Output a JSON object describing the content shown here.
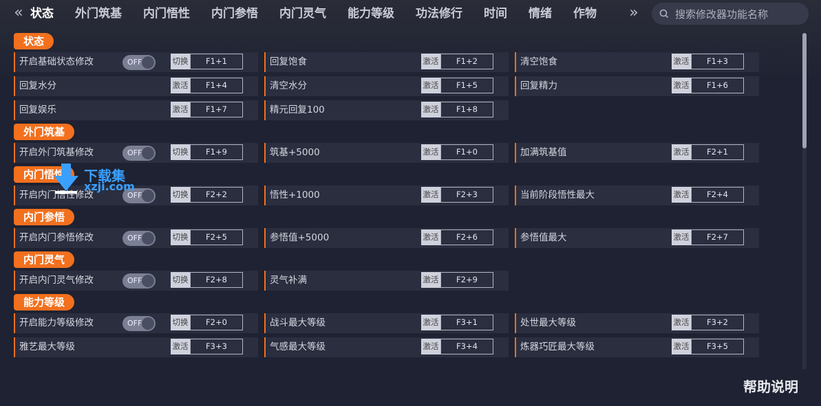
{
  "nav": {
    "prev_icon": "chevron-left-double-icon",
    "next_icon": "chevron-right-double-icon"
  },
  "tabs": [
    {
      "label": "状态",
      "active": true
    },
    {
      "label": "外门筑基"
    },
    {
      "label": "内门悟性"
    },
    {
      "label": "内门参悟"
    },
    {
      "label": "内门灵气"
    },
    {
      "label": "能力等级"
    },
    {
      "label": "功法修行"
    },
    {
      "label": "时间"
    },
    {
      "label": "情绪"
    },
    {
      "label": "作物"
    }
  ],
  "search": {
    "placeholder": "搜索修改器功能名称"
  },
  "help_label": "帮助说明",
  "watermark": {
    "line1": "下载集",
    "line2": "xzji.com"
  },
  "colors": {
    "accent": "#f2701e",
    "background": "#1e2232",
    "cell": "#2a2e3f",
    "watermark": "#3aa0ff"
  },
  "sections": [
    {
      "title": "状态",
      "rows": [
        [
          {
            "label": "开启基础状态修改",
            "toggle": "OFF",
            "action": "切换",
            "key": "F1+1"
          },
          {
            "label": "回复饱食",
            "action": "激活",
            "key": "F1+2"
          },
          {
            "label": "清空饱食",
            "action": "激活",
            "key": "F1+3"
          }
        ],
        [
          {
            "label": "回复水分",
            "action": "激活",
            "key": "F1+4"
          },
          {
            "label": "清空水分",
            "action": "激活",
            "key": "F1+5"
          },
          {
            "label": "回复精力",
            "action": "激活",
            "key": "F1+6"
          }
        ],
        [
          {
            "label": "回复娱乐",
            "action": "激活",
            "key": "F1+7"
          },
          {
            "label": "精元回复100",
            "action": "激活",
            "key": "F1+8"
          }
        ]
      ]
    },
    {
      "title": "外门筑基",
      "rows": [
        [
          {
            "label": "开启外门筑基修改",
            "toggle": "OFF",
            "action": "切换",
            "key": "F1+9"
          },
          {
            "label": "筑基+5000",
            "action": "激活",
            "key": "F1+0"
          },
          {
            "label": "加满筑基值",
            "action": "激活",
            "key": "F2+1"
          }
        ]
      ]
    },
    {
      "title": "内门悟性",
      "rows": [
        [
          {
            "label": "开启内门悟性修改",
            "toggle": "OFF",
            "action": "切换",
            "key": "F2+2"
          },
          {
            "label": "悟性+1000",
            "action": "激活",
            "key": "F2+3"
          },
          {
            "label": "当前阶段悟性最大",
            "action": "激活",
            "key": "F2+4"
          }
        ]
      ]
    },
    {
      "title": "内门参悟",
      "rows": [
        [
          {
            "label": "开启内门参悟修改",
            "toggle": "OFF",
            "action": "切换",
            "key": "F2+5"
          },
          {
            "label": "参悟值+5000",
            "action": "激活",
            "key": "F2+6"
          },
          {
            "label": "参悟值最大",
            "action": "激活",
            "key": "F2+7"
          }
        ]
      ]
    },
    {
      "title": "内门灵气",
      "rows": [
        [
          {
            "label": "开启内门灵气修改",
            "toggle": "OFF",
            "action": "切换",
            "key": "F2+8"
          },
          {
            "label": "灵气补满",
            "action": "激活",
            "key": "F2+9"
          }
        ]
      ]
    },
    {
      "title": "能力等级",
      "rows": [
        [
          {
            "label": "开启能力等级修改",
            "toggle": "OFF",
            "action": "切换",
            "key": "F2+0"
          },
          {
            "label": "战斗最大等级",
            "action": "激活",
            "key": "F3+1"
          },
          {
            "label": "处世最大等级",
            "action": "激活",
            "key": "F3+2"
          }
        ],
        [
          {
            "label": "雅艺最大等级",
            "action": "激活",
            "key": "F3+3"
          },
          {
            "label": "气感最大等级",
            "action": "激活",
            "key": "F3+4"
          },
          {
            "label": "炼器巧匠最大等级",
            "action": "激活",
            "key": "F3+5"
          }
        ]
      ]
    }
  ]
}
